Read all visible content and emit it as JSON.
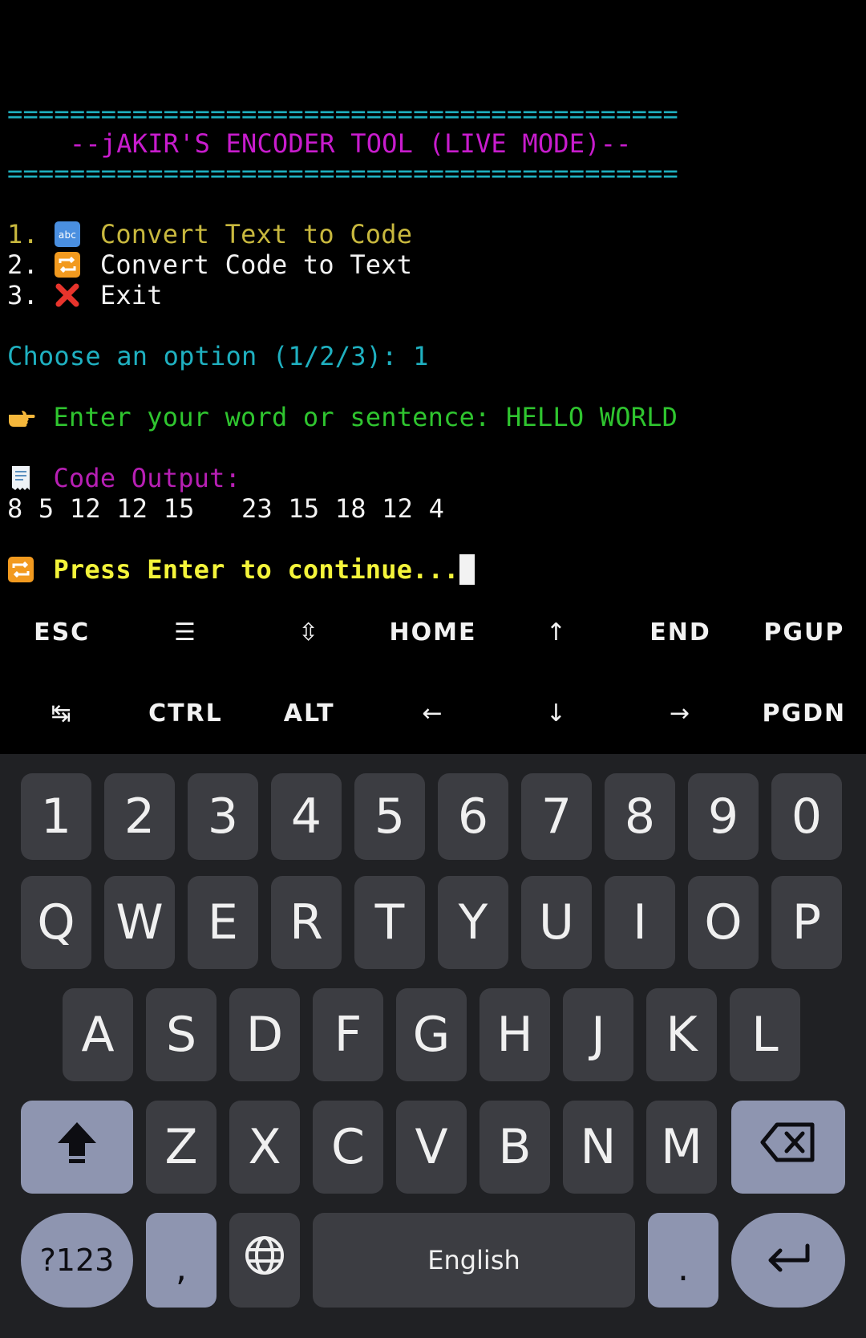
{
  "terminal": {
    "separator_top": "===========================================",
    "title": "    --jAKIR'S ENCODER TOOL (LIVE MODE)--",
    "separator_bottom": "===========================================",
    "menu": [
      {
        "num": "1. ",
        "icon": "abc-input-icon",
        "label": "Convert Text to Code"
      },
      {
        "num": "2. ",
        "icon": "repeat-icon",
        "label": "Convert Code to Text"
      },
      {
        "num": "3. ",
        "icon": "cross-mark-icon",
        "label": "Exit"
      }
    ],
    "prompt_choice": "Choose an option (1/2/3): 1",
    "prompt_input_label": "Enter your word or sentence: ",
    "prompt_input_value": "HELLO WORLD",
    "output_label": "Code Output:",
    "output_value": "8 5 12 12 15   23 15 18 12 4",
    "continue_text": "Press Enter to continue..."
  },
  "extra_keys": {
    "row1": [
      "ESC",
      "☰",
      "⇳",
      "HOME",
      "↑",
      "END",
      "PGUP"
    ],
    "row2": [
      "↹",
      "CTRL",
      "ALT",
      "←",
      "↓",
      "→",
      "PGDN"
    ]
  },
  "keyboard": {
    "numbers": [
      "1",
      "2",
      "3",
      "4",
      "5",
      "6",
      "7",
      "8",
      "9",
      "0"
    ],
    "row_q": [
      "Q",
      "W",
      "E",
      "R",
      "T",
      "Y",
      "U",
      "I",
      "O",
      "P"
    ],
    "row_a": [
      "A",
      "S",
      "D",
      "F",
      "G",
      "H",
      "J",
      "K",
      "L"
    ],
    "row_z": [
      "Z",
      "X",
      "C",
      "V",
      "B",
      "N",
      "M"
    ],
    "symbols_key": "?123",
    "comma_key": ",",
    "space_label": "English",
    "period_key": ".",
    "colors": {
      "background": "#202124",
      "key": "#3c3d42",
      "function_key": "#8e95b0"
    }
  }
}
